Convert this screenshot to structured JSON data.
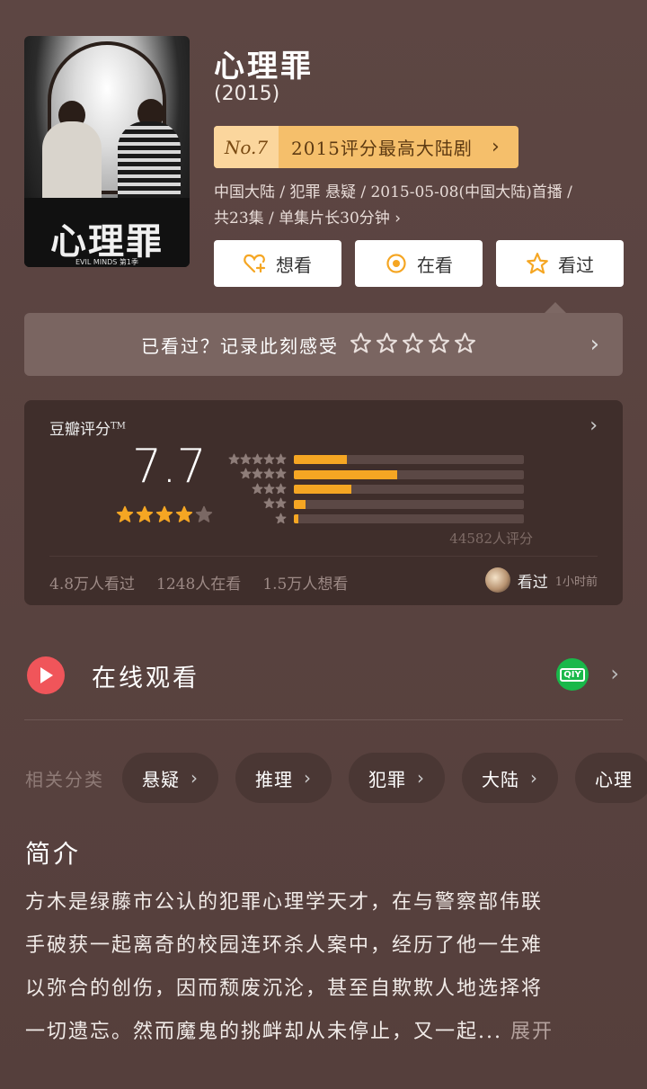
{
  "movie": {
    "title": "心理罪",
    "year": "(2015)",
    "rank_no": "No.7",
    "rank_text": "2015评分最高大陆剧",
    "meta_line1": "中国大陆 / 犯罪 悬疑 / 2015-05-08(中国大陆)首播 /",
    "meta_line2": "共23集 / 单集片长30分钟",
    "poster_title": "心理罪",
    "poster_sub": "EVIL MINDS 第1季"
  },
  "actions": [
    {
      "label": "想看",
      "icon": "heart-plus-icon"
    },
    {
      "label": "在看",
      "icon": "target-circle-icon"
    },
    {
      "label": "看过",
      "icon": "star-outline-icon"
    }
  ],
  "watched": {
    "prompt": "已看过？记录此刻感受",
    "stars": 5
  },
  "rating": {
    "label": "豆瓣评分",
    "tm": "TM",
    "score": "7.7",
    "stars_filled": 4,
    "stars_total": 5,
    "count": "44582人评分",
    "distribution": [
      {
        "stars": 5,
        "fraction": 0.23
      },
      {
        "stars": 4,
        "fraction": 0.45
      },
      {
        "stars": 3,
        "fraction": 0.25
      },
      {
        "stars": 2,
        "fraction": 0.05
      },
      {
        "stars": 1,
        "fraction": 0.02
      }
    ],
    "watched_count": "4.8万人看过",
    "watching_count": "1248人在看",
    "want_count": "1.5万人想看",
    "friend_label": "看过",
    "friend_time": "1小时前"
  },
  "online": {
    "label": "在线观看",
    "provider_badge": "QIY"
  },
  "categories": {
    "label": "相关分类",
    "items": [
      "悬疑",
      "推理",
      "犯罪",
      "大陆",
      "心理"
    ]
  },
  "summary": {
    "heading": "简介",
    "line1": "方木是绿藤市公认的犯罪心理学天才，在与警察部伟联",
    "line2": "手破获一起离奇的校园连环杀人案中，经历了他一生难",
    "line3": "以弥合的创伤，因而颓废沉沦，甚至自欺欺人地选择将",
    "line4": "一切遗忘。然而魔鬼的挑衅却从未停止，又一起...",
    "more": "展开"
  },
  "colors": {
    "accent_gold": "#f5bf6b",
    "bar_fill": "#f5a623",
    "star_fill": "#f5a623",
    "play_red": "#f0555a",
    "iqiyi_green": "#19b84a"
  }
}
